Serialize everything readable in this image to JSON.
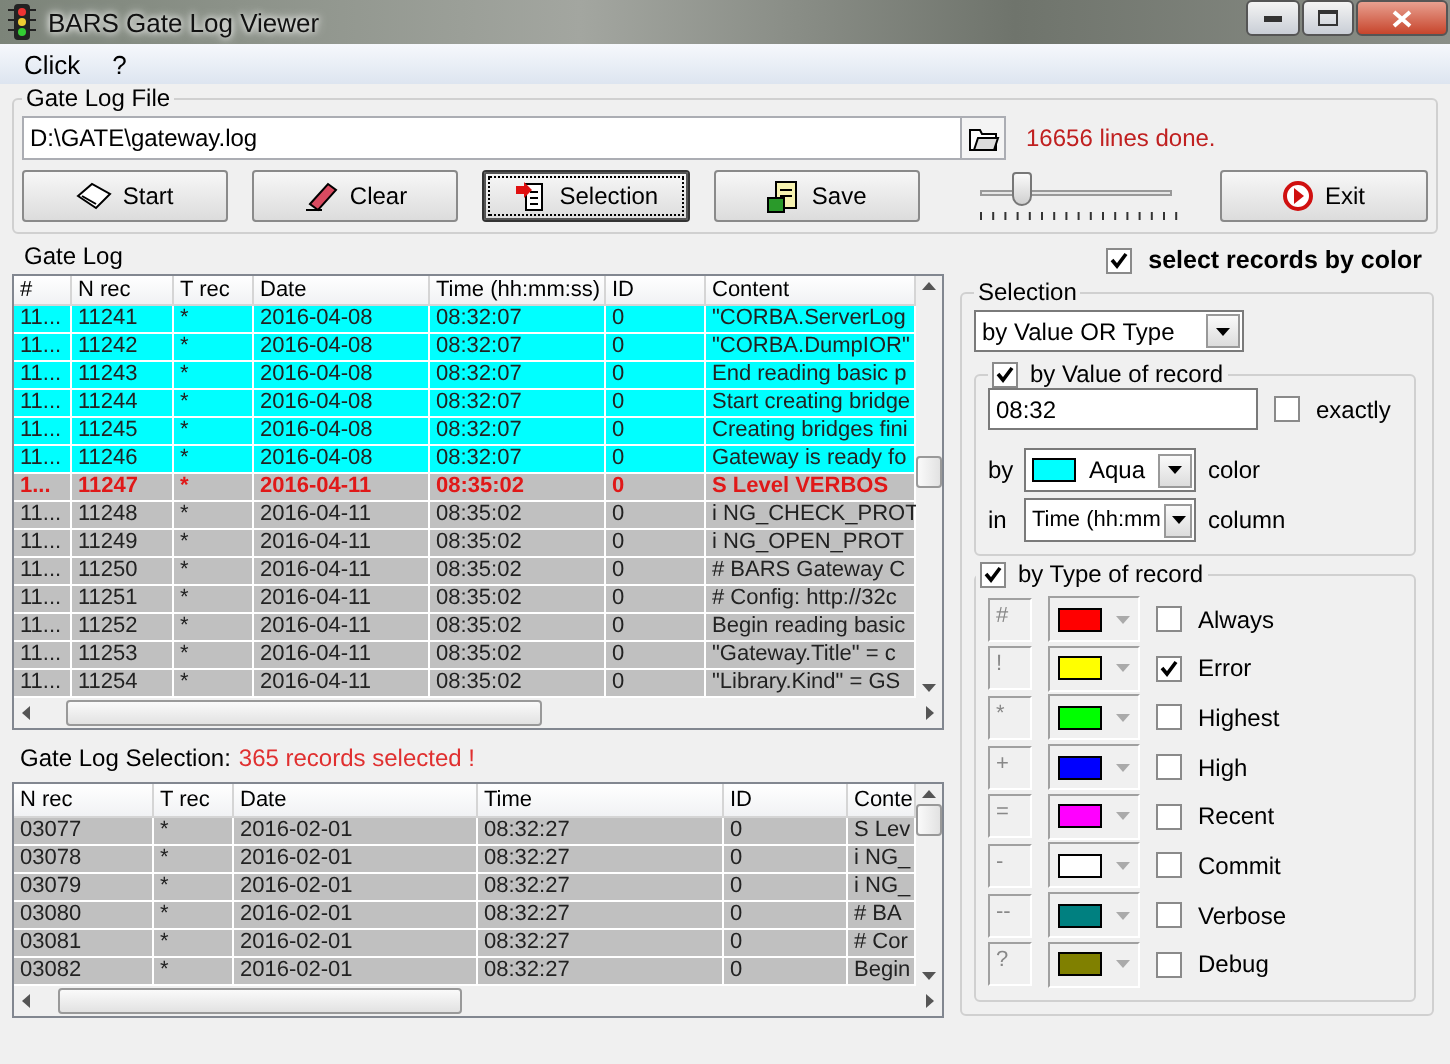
{
  "window": {
    "title": "BARS Gate Log Viewer"
  },
  "menu": [
    {
      "label": "Click"
    },
    {
      "label": "?"
    }
  ],
  "gate_log_file": {
    "title": "Gate Log File",
    "path": "D:\\GATE\\gateway.log",
    "status": "16656 lines done."
  },
  "buttons": [
    {
      "label": "Start",
      "kind": "start",
      "focused": false
    },
    {
      "label": "Clear",
      "kind": "clear",
      "focused": false
    },
    {
      "label": "Selection",
      "kind": "selection",
      "focused": true
    },
    {
      "label": "Save",
      "kind": "save",
      "focused": false
    }
  ],
  "speed_slider": {
    "level": 0.2
  },
  "exit_button": {
    "label": "Exit"
  },
  "gate_log": {
    "title": "Gate Log",
    "columns": [
      "#",
      "N rec",
      "T rec",
      "Date",
      "Time (hh:mm:ss)",
      "ID",
      "Content"
    ],
    "rows": [
      {
        "cells": [
          "11...",
          "11241",
          "*",
          "2016-04-08",
          "08:32:07",
          "0",
          "\"CORBA.ServerLog"
        ],
        "color": "#00ffff",
        "error": false
      },
      {
        "cells": [
          "11...",
          "11242",
          "*",
          "2016-04-08",
          "08:32:07",
          "0",
          "\"CORBA.DumpIOR\""
        ],
        "color": "#00ffff",
        "error": false
      },
      {
        "cells": [
          "11...",
          "11243",
          "*",
          "2016-04-08",
          "08:32:07",
          "0",
          "End reading basic p"
        ],
        "color": "#00ffff",
        "error": false
      },
      {
        "cells": [
          "11...",
          "11244",
          "*",
          "2016-04-08",
          "08:32:07",
          "0",
          "Start creating bridge"
        ],
        "color": "#00ffff",
        "error": false
      },
      {
        "cells": [
          "11...",
          "11245",
          "*",
          "2016-04-08",
          "08:32:07",
          "0",
          "Creating bridges fini"
        ],
        "color": "#00ffff",
        "error": false
      },
      {
        "cells": [
          "11...",
          "11246",
          "*",
          "2016-04-08",
          "08:32:07",
          "0",
          "Gateway is ready fo"
        ],
        "color": "#00ffff",
        "error": false
      },
      {
        "cells": [
          "1...",
          "11247",
          "*",
          "2016-04-11",
          "08:35:02",
          "0",
          "S Level VERBOS"
        ],
        "color": "#c0c0c0",
        "error": true
      },
      {
        "cells": [
          "11...",
          "11248",
          "*",
          "2016-04-11",
          "08:35:02",
          "0",
          "i NG_CHECK_PROT"
        ],
        "color": "#c0c0c0",
        "error": false
      },
      {
        "cells": [
          "11...",
          "11249",
          "*",
          "2016-04-11",
          "08:35:02",
          "0",
          "i NG_OPEN_PROT"
        ],
        "color": "#c0c0c0",
        "error": false
      },
      {
        "cells": [
          "11...",
          "11250",
          "*",
          "2016-04-11",
          "08:35:02",
          "0",
          "# BARS Gateway C"
        ],
        "color": "#c0c0c0",
        "error": false
      },
      {
        "cells": [
          "11...",
          "11251",
          "*",
          "2016-04-11",
          "08:35:02",
          "0",
          "# Config: http://32c"
        ],
        "color": "#c0c0c0",
        "error": false
      },
      {
        "cells": [
          "11...",
          "11252",
          "*",
          "2016-04-11",
          "08:35:02",
          "0",
          "Begin reading basic"
        ],
        "color": "#c0c0c0",
        "error": false
      },
      {
        "cells": [
          "11...",
          "11253",
          "*",
          "2016-04-11",
          "08:35:02",
          "0",
          "\"Gateway.Title\" = c"
        ],
        "color": "#c0c0c0",
        "error": false
      },
      {
        "cells": [
          "11...",
          "11254",
          "*",
          "2016-04-11",
          "08:35:02",
          "0",
          "\"Library.Kind\" = GS"
        ],
        "color": "#c0c0c0",
        "error": false
      }
    ]
  },
  "selection_log": {
    "label": "Gate Log Selection:",
    "count": "365 records selected !",
    "columns": [
      "N rec",
      "T rec",
      "Date",
      "Time",
      "ID",
      "Conte"
    ],
    "rows": [
      {
        "cells": [
          "03077",
          "*",
          "2016-02-01",
          "08:32:27",
          "0",
          "S Lev"
        ],
        "color": "#c0c0c0",
        "error": false
      },
      {
        "cells": [
          "03078",
          "*",
          "2016-02-01",
          "08:32:27",
          "0",
          "i NG_"
        ],
        "color": "#c0c0c0",
        "error": false
      },
      {
        "cells": [
          "03079",
          "*",
          "2016-02-01",
          "08:32:27",
          "0",
          "i NG_"
        ],
        "color": "#c0c0c0",
        "error": false
      },
      {
        "cells": [
          "03080",
          "*",
          "2016-02-01",
          "08:32:27",
          "0",
          "# BA"
        ],
        "color": "#c0c0c0",
        "error": false
      },
      {
        "cells": [
          "03081",
          "*",
          "2016-02-01",
          "08:32:27",
          "0",
          "# Cor"
        ],
        "color": "#c0c0c0",
        "error": false
      },
      {
        "cells": [
          "03082",
          "*",
          "2016-02-01",
          "08:32:27",
          "0",
          "Begin"
        ],
        "color": "#c0c0c0",
        "error": false
      }
    ]
  },
  "filter": {
    "select_by_color": {
      "label": "select records by color",
      "checked": true
    },
    "selection": {
      "title": "Selection",
      "mode": "by Value OR Type"
    },
    "by_value": {
      "label": "by Value of record",
      "checked": true,
      "value": "08:32",
      "exactly": {
        "label": "exactly",
        "checked": false
      },
      "by_label": "by",
      "color_name": "Aqua",
      "color": "#00ffff",
      "color_label": "color",
      "in_label": "in",
      "column": "Time (hh:mm",
      "column_label": "column"
    },
    "by_type": {
      "label": "by Type of record",
      "checked": true,
      "types": [
        {
          "symbol": "#",
          "color": "#ff0000",
          "label": "Always",
          "checked": false
        },
        {
          "symbol": "!",
          "color": "#ffff00",
          "label": "Error",
          "checked": true
        },
        {
          "symbol": "*",
          "color": "#00ff00",
          "label": "Highest",
          "checked": false
        },
        {
          "symbol": "+",
          "color": "#0000ff",
          "label": "High",
          "checked": false
        },
        {
          "symbol": "=",
          "color": "#ff00ff",
          "label": "Recent",
          "checked": false
        },
        {
          "symbol": "-",
          "color": "#ffffff",
          "label": "Commit",
          "checked": false
        },
        {
          "symbol": "--",
          "color": "#008080",
          "label": "Verbose",
          "checked": false
        },
        {
          "symbol": "?",
          "color": "#808000",
          "label": "Debug",
          "checked": false
        }
      ]
    }
  }
}
